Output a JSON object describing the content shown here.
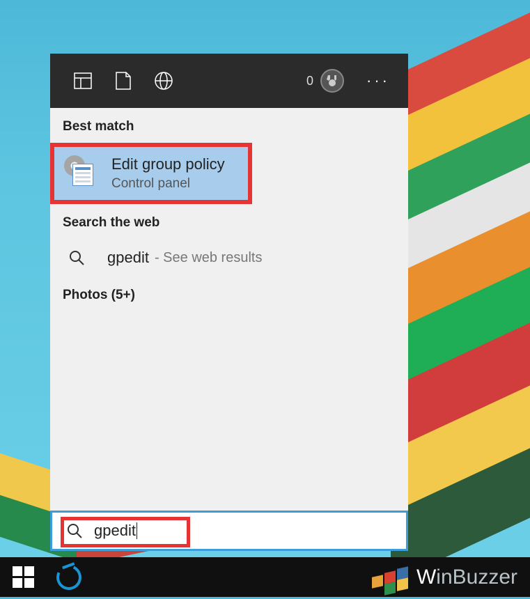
{
  "header": {
    "score": "0"
  },
  "sections": {
    "best_match_label": "Best match",
    "search_web_label": "Search the web",
    "photos_label": "Photos (5+)"
  },
  "best_match": {
    "title": "Edit group policy",
    "subtitle": "Control panel"
  },
  "web_result": {
    "query": "gpedit",
    "hint": "- See web results"
  },
  "search_input": {
    "value": "gpedit"
  },
  "watermark": {
    "brand_prefix": "W",
    "brand_rest": "inBuzzer"
  }
}
